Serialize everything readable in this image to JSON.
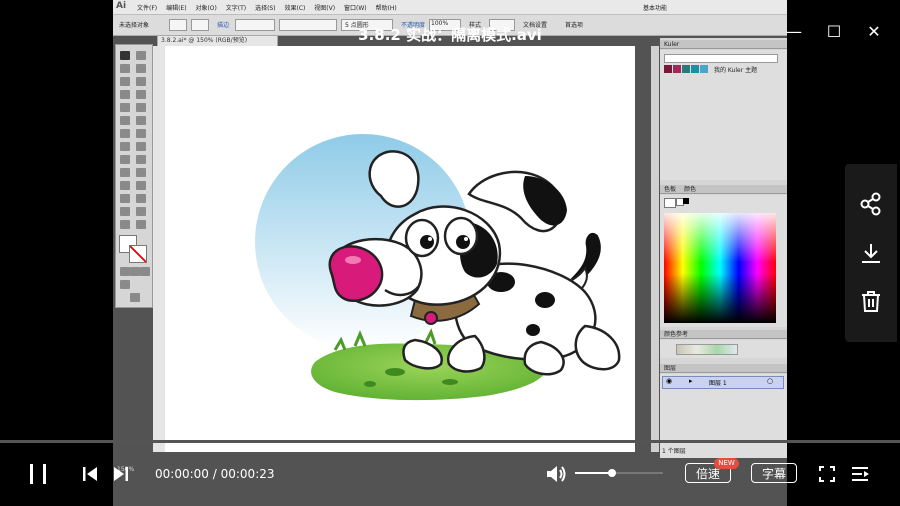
{
  "video": {
    "title": "3.8.2 实战：隔离模式.avi",
    "current_time": "00:00:00",
    "separator": "/",
    "duration": "00:00:23",
    "progress": 0.0,
    "volume": 0.42
  },
  "window_controls": {
    "minimize": "—",
    "maximize": "☐",
    "close": "✕"
  },
  "player_controls": {
    "speed_label": "倍速",
    "speed_badge": "NEW",
    "subtitle_label": "字幕"
  },
  "side_actions": [
    "share-icon",
    "download-icon",
    "delete-icon"
  ],
  "illustrator": {
    "app_logo": "Ai",
    "menus": [
      "文件(F)",
      "编辑(E)",
      "对象(O)",
      "文字(T)",
      "选择(S)",
      "效果(C)",
      "视图(V)",
      "窗口(W)",
      "帮助(H)"
    ],
    "workspace": "基本功能",
    "control_bar": {
      "selection_label": "未选择对象",
      "stroke_label": "描边",
      "point_label": "5 点圆形",
      "opacity_label": "不透明度",
      "opacity_value": "100%",
      "style_label": "样式",
      "doc_setup": "文档设置",
      "prefs": "首选项"
    },
    "doc_tab": "3.8.2.ai* @ 150% (RGB/预览)",
    "panels": {
      "kuler_title": "Kuler",
      "kuler_theme": "我的 Kuler 主题",
      "color_tabs": [
        "色板",
        "颜色"
      ],
      "color_guide": "颜色参考",
      "layers_title": "图层",
      "layer_name": "图层 1",
      "layers_count": "1 个图层"
    },
    "status_zoom": "150%"
  },
  "colors": {
    "accent_red": "#e74c3c",
    "canvas_bg": "#ffffff",
    "sky_blue": "#8fcbe8",
    "grass_green": "#6cbf3b",
    "nose_pink": "#d81b7b",
    "collar_brown": "#8b6a3f"
  }
}
